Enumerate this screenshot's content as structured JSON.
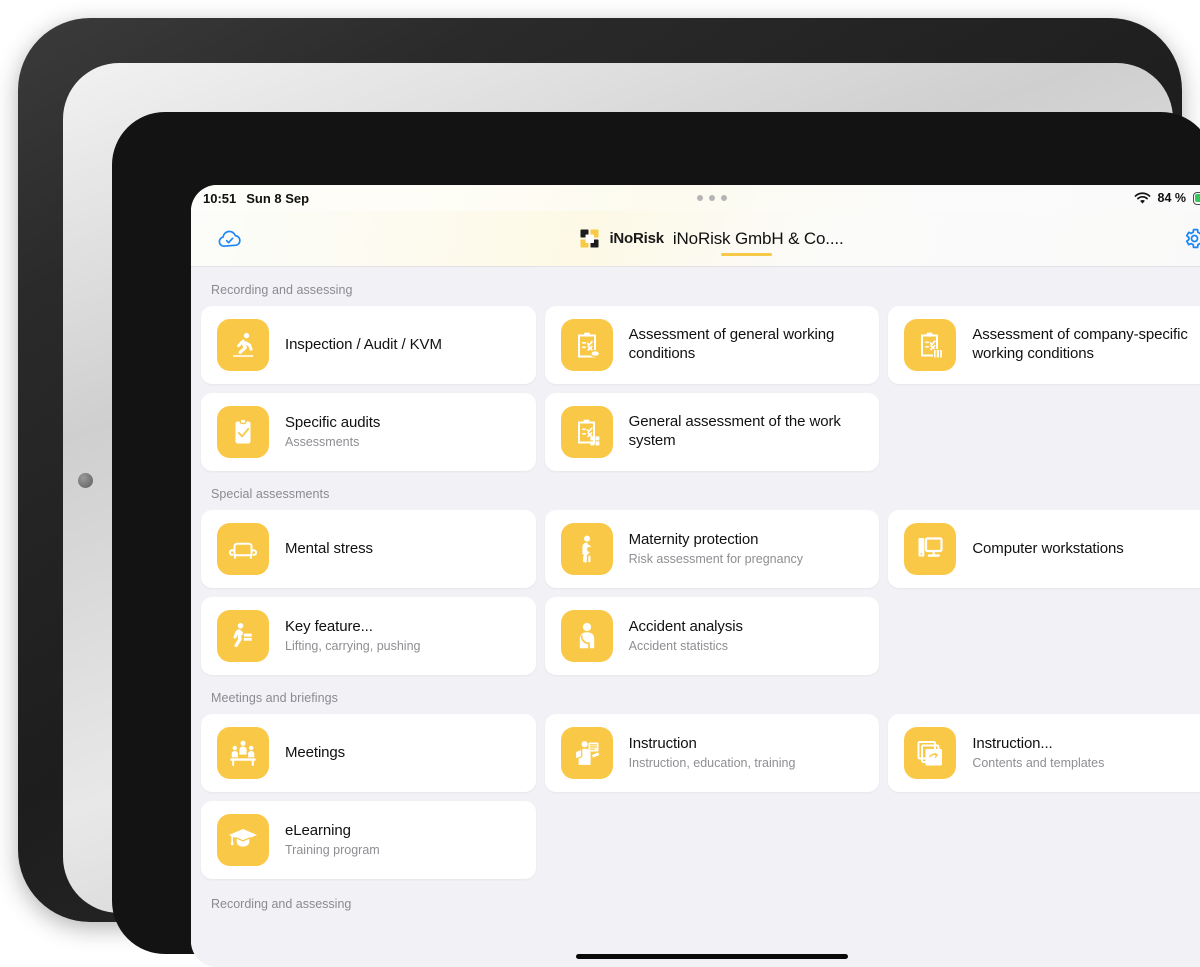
{
  "status_bar": {
    "time": "10:51",
    "date": "Sun 8 Sep",
    "battery_percent": "84 %",
    "battery_level": 84,
    "wifi_icon": "wifi-icon",
    "battery_icon": "battery-charging-icon",
    "multitask_icon": "multitasking-dots-icon"
  },
  "header": {
    "sync_icon": "cloud-check-icon",
    "logo_icon": "inorisk-logo-icon",
    "logo_text": "iNoRisk",
    "title": "iNoRisk GmbH & Co....",
    "settings_icon": "gear-icon",
    "accent_color": "#f6c948"
  },
  "theme": {
    "icon_tile_color": "#f9c846",
    "accent_blue": "#1b86f7",
    "background": "#f2f2f6",
    "card_background": "#ffffff"
  },
  "sections": [
    {
      "title": "Recording and assessing",
      "cards": [
        {
          "title": "Inspection / Audit / KVM",
          "subtitle": "",
          "icon": "running-person-icon"
        },
        {
          "title": "Assessment of general working conditions",
          "subtitle": "",
          "icon": "clipboard-check-eraser-icon"
        },
        {
          "title": "Assessment of company-specific working conditions",
          "subtitle": "",
          "icon": "clipboard-check-building-icon"
        },
        {
          "title": "Specific audits",
          "subtitle": "Assessments",
          "icon": "clipboard-tick-icon"
        },
        {
          "title": "General assessment of the work system",
          "subtitle": "",
          "icon": "clipboard-check-grid-icon"
        }
      ]
    },
    {
      "title": "Special assessments",
      "cards": [
        {
          "title": "Mental stress",
          "subtitle": "",
          "icon": "armchair-icon"
        },
        {
          "title": "Maternity protection",
          "subtitle": "Risk assessment for pregnancy",
          "icon": "pregnant-person-icon"
        },
        {
          "title": "Computer workstations",
          "subtitle": "",
          "icon": "desktop-monitor-icon"
        },
        {
          "title": "Key feature...",
          "subtitle": "Lifting, carrying, pushing",
          "icon": "person-lifting-box-icon"
        },
        {
          "title": "Accident analysis",
          "subtitle": "Accident statistics",
          "icon": "injured-person-arm-sling-icon"
        }
      ]
    },
    {
      "title": "Meetings and briefings",
      "cards": [
        {
          "title": "Meetings",
          "subtitle": "",
          "icon": "people-at-table-icon"
        },
        {
          "title": "Instruction",
          "subtitle": "Instruction, education, training",
          "icon": "person-presenting-document-icon"
        },
        {
          "title": "Instruction...",
          "subtitle": "Contents and templates",
          "icon": "stacked-documents-icon"
        },
        {
          "title": "eLearning",
          "subtitle": "Training program",
          "icon": "graduation-cap-icon"
        }
      ]
    }
  ],
  "footer_peek": {
    "label": "Recording and assessing"
  }
}
